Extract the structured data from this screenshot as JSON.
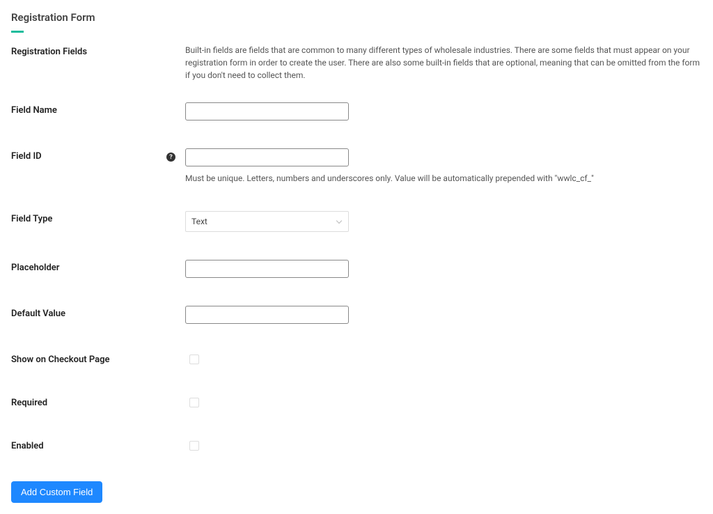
{
  "header": {
    "page_title": "Registration Form"
  },
  "section": {
    "heading": "Registration Fields",
    "description": "Built-in fields are fields that are common to many different types of wholesale industries. There are some fields that must appear on your registration form in order to create the user. There are also some built-in fields that are optional, meaning that can be omitted from the form if you don't need to collect them."
  },
  "fields": {
    "field_name": {
      "label": "Field Name",
      "value": ""
    },
    "field_id": {
      "label": "Field ID",
      "value": "",
      "helper": "Must be unique. Letters, numbers and underscores only. Value will be automatically prepended with \"wwlc_cf_\""
    },
    "field_type": {
      "label": "Field Type",
      "selected": "Text"
    },
    "placeholder": {
      "label": "Placeholder",
      "value": ""
    },
    "default_value": {
      "label": "Default Value",
      "value": ""
    },
    "show_on_checkout": {
      "label": "Show on Checkout Page"
    },
    "required": {
      "label": "Required"
    },
    "enabled": {
      "label": "Enabled"
    }
  },
  "actions": {
    "add_custom_field": "Add Custom Field"
  }
}
